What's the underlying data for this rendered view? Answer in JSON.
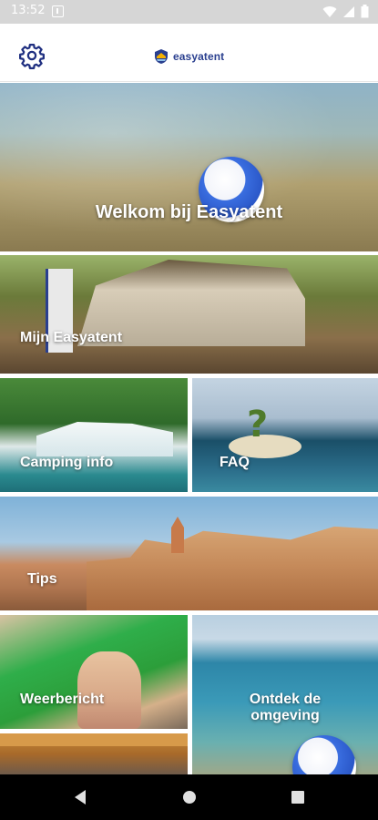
{
  "status_bar": {
    "time": "13:52",
    "icons": [
      "notification-icon",
      "wifi-icon",
      "signal-icon",
      "battery-icon"
    ]
  },
  "header": {
    "brand_name": "easyatent",
    "icons": [
      "settings-gear-icon",
      "brand-logo-icon"
    ]
  },
  "tiles": [
    {
      "label": "Welkom bij Easyatent"
    },
    {
      "label": "Mijn Easyatent"
    },
    {
      "label": "Camping info"
    },
    {
      "label": "FAQ"
    },
    {
      "label": "Tips"
    },
    {
      "label": "Weerbericht"
    },
    {
      "label_line1": "Ontdek de",
      "label_line2": "omgeving"
    }
  ],
  "nav_bar": {
    "icons": [
      "back-icon",
      "home-icon",
      "recents-icon"
    ]
  },
  "colors": {
    "brand_blue": "#2a3f8f",
    "accent_yellow": "#f5b000",
    "header_bg": "#ffffff",
    "status_bar_bg": "#d6d6d6",
    "nav_bar_bg": "#000000"
  }
}
